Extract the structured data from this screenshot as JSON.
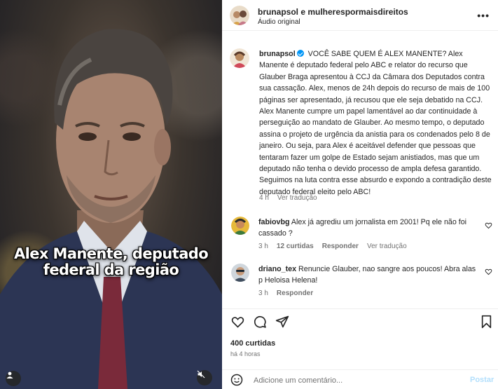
{
  "header": {
    "author_line": "brunapsol e mulherespormaisdireitos",
    "audio": "Áudio original",
    "more": "•••"
  },
  "media": {
    "caption_line1": "Alex Manente, deputado",
    "caption_line2": "federal da região",
    "icons": [
      "user-tag-icon",
      "mute-icon"
    ]
  },
  "caption": {
    "username": "brunapsol",
    "text": "VOCÊ SABE QUEM É ALEX MANENTE? Alex Manente é deputado federal pelo ABC e relator do recurso que Glauber Braga apresentou à CCJ da Câmara dos Deputados contra sua cassação. Alex, menos de 24h depois do recurso de mais de 100 páginas ser apresentado, já recusou que ele seja debatido na CCJ. Alex Manente cumpre um papel lamentável ao dar continuidade à perseguição ao mandato de Glauber. Ao mesmo tempo, o deputado assina o projeto de urgência da anistia para os condenados pelo 8 de janeiro. Ou seja, para Alex é aceitável defender que pessoas que tentaram fazer um golpe de Estado sejam anistiados, mas que um deputado não tenha o devido processo de ampla defesa garantido. Seguimos na luta contra esse absurdo e expondo a contradição deste deputado federal eleito pelo ABC!",
    "time": "4 h",
    "translate": "Ver tradução"
  },
  "comments": [
    {
      "username": "fabiovbg",
      "text": "Alex já agrediu um jornalista em 2001! Pq ele não foi cassado ?",
      "time": "3 h",
      "likes": "12 curtidas",
      "reply": "Responder",
      "translate": "Ver tradução"
    },
    {
      "username": "driano_tex",
      "text": "Renuncie Glauber, nao sangre aos poucos! Abra alas p Heloisa Helena!",
      "time": "3 h",
      "reply": "Responder"
    }
  ],
  "footer": {
    "likes": "400 curtidas",
    "posted": "há 4 horas",
    "comment_placeholder": "Adicione um comentário...",
    "post_label": "Postar"
  },
  "colors": {
    "link_disabled": "#b2dffc",
    "verified": "#0095f6",
    "muted_text": "#737373"
  }
}
